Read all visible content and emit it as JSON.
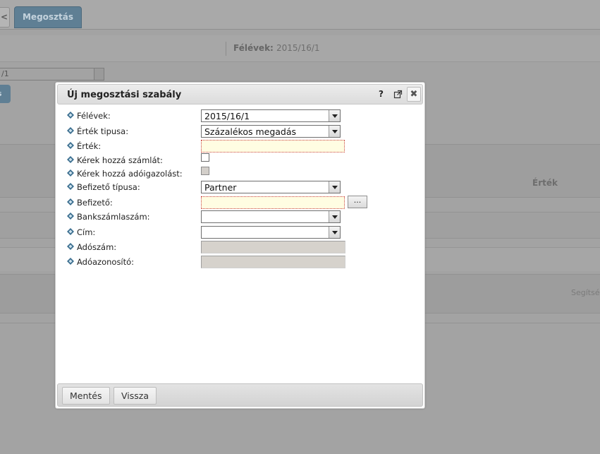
{
  "background": {
    "tab_left_label": "<",
    "tab_active_label": "Megosztás",
    "filter_label": "Félévek:",
    "filter_value": "2015/16/1",
    "select_value": "/1",
    "button_label": "s",
    "column_header": "Érték",
    "help_text": "Segítsé"
  },
  "dialog": {
    "title": "Új megosztási szabály",
    "help_label": "?",
    "close_label": "✖",
    "fields": {
      "felevek": {
        "label": "Félévek:",
        "value": "2015/16/1"
      },
      "ertek_tipusa": {
        "label": "Érték tipusa:",
        "value": "Százalékos megadás"
      },
      "ertek": {
        "label": "Érték:",
        "value": ""
      },
      "szamla": {
        "label": "Kérek hozzá számlát:"
      },
      "adoigazolas": {
        "label": "Kérek hozzá adóigazolást:"
      },
      "befizeto_tipusa": {
        "label": "Befizető típusa:",
        "value": "Partner"
      },
      "befizeto": {
        "label": "Befizető:",
        "value": "",
        "browse_label": "..."
      },
      "bankszamlaszam": {
        "label": "Bankszámlaszám:",
        "value": ""
      },
      "cim": {
        "label": "Cím:",
        "value": ""
      },
      "adoszam": {
        "label": "Adószám:",
        "value": ""
      },
      "adoazonosito": {
        "label": "Adóazonosító:",
        "value": ""
      }
    },
    "footer": {
      "save_label": "Mentés",
      "back_label": "Vissza"
    }
  },
  "colors": {
    "tab_active": "#5f7f94",
    "required_field_bg": "#fffde2",
    "readonly_field_bg": "#d6d2cc",
    "diamond_icon": "#3b6e8f"
  }
}
